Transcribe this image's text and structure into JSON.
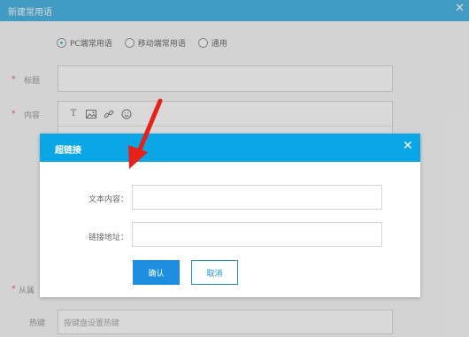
{
  "dialog": {
    "title": "新建常用语",
    "close": "✕",
    "accent": "#2ea9df"
  },
  "scope_options": [
    {
      "label": "PC端常用语",
      "selected": true
    },
    {
      "label": "移动端常用语",
      "selected": false
    },
    {
      "label": "通用",
      "selected": false
    }
  ],
  "form": {
    "required_mark": "*",
    "title_label": "标题",
    "content_label": "内容",
    "from_label": "从属",
    "hotkey_label": "热键",
    "hotkey_placeholder": "按键盘设置热键"
  },
  "toolbar": {
    "text_icon": "T",
    "image_icon": "image-icon",
    "link_icon": "link-icon",
    "emoji_icon": "emoji-icon"
  },
  "modal": {
    "title": "超链接",
    "close": "✕",
    "header_color": "#0aa6e6",
    "text_label": "文本内容：",
    "url_label": "链接地址：",
    "ok_label": "确认",
    "cancel_label": "取消",
    "text_value": "",
    "url_value": ""
  },
  "annotation": {
    "arrow_color": "#e8201a"
  }
}
